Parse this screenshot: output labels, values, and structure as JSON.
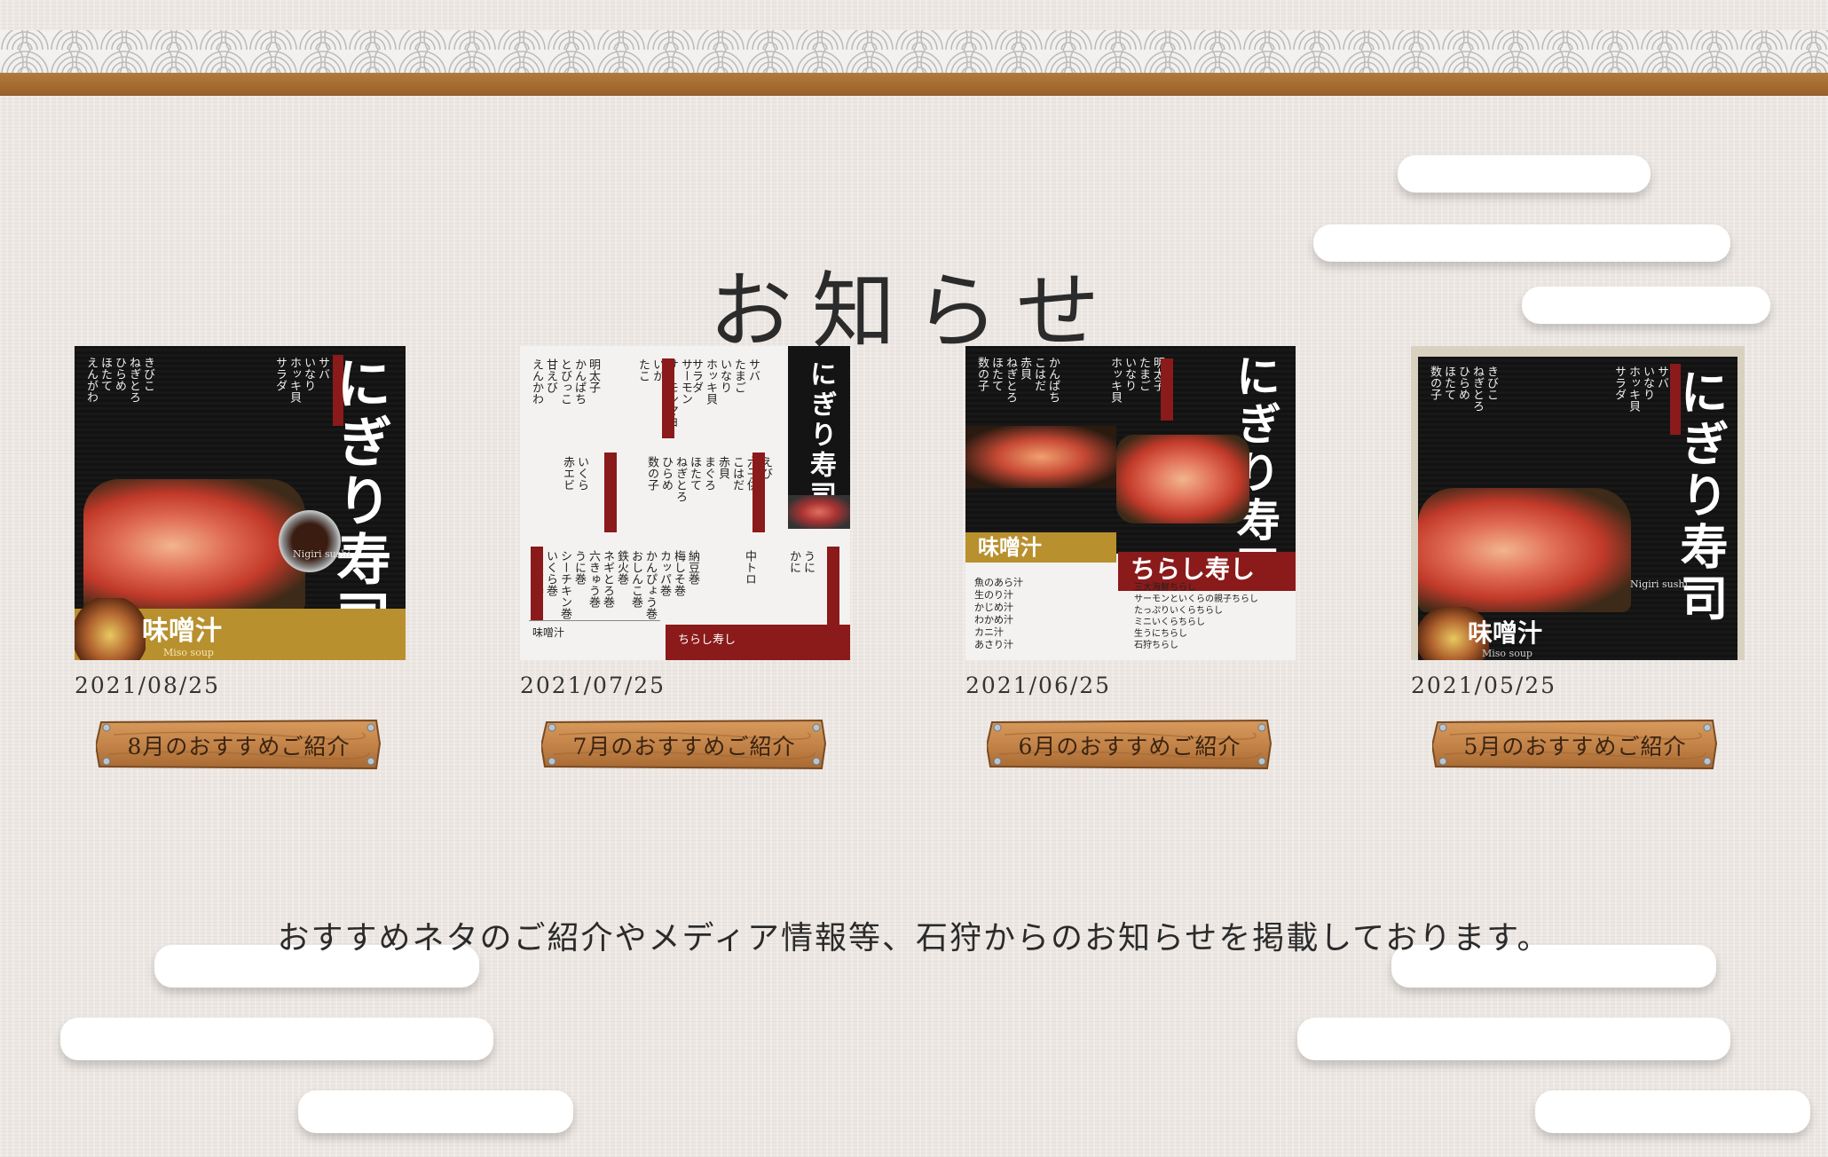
{
  "page_title": "お知らせ",
  "news": [
    {
      "date": "2021/08/25",
      "button_label": "8月のおすすめご紹介",
      "thumbnail": {
        "menu_title": "にぎり寿司",
        "sub_title": "味噌汁",
        "caption": "Miso soup",
        "latin": "Nigiri sushi"
      }
    },
    {
      "date": "2021/07/25",
      "button_label": "7月のおすすめご紹介",
      "thumbnail": {
        "menu_title": "にぎり寿司",
        "sub_title": "味噌汁",
        "caption": "ちらし寿し"
      }
    },
    {
      "date": "2021/06/25",
      "button_label": "6月のおすすめご紹介",
      "thumbnail": {
        "menu_title": "にぎり寿司",
        "sub_title": "味噌汁",
        "caption": "ちらし寿し"
      }
    },
    {
      "date": "2021/05/25",
      "button_label": "5月のおすすめご紹介",
      "thumbnail": {
        "menu_title": "にぎり寿司",
        "sub_title": "味噌汁",
        "caption": "Miso soup",
        "latin": "Nigiri sushi"
      }
    }
  ],
  "footer_text": "おすすめネタのご紹介やメディア情報等、石狩からのお知らせを掲載しております。",
  "colors": {
    "wood": "#a46a30",
    "menu_black": "#141414",
    "menu_red": "#8b1a1a",
    "gold": "#b8902e"
  }
}
